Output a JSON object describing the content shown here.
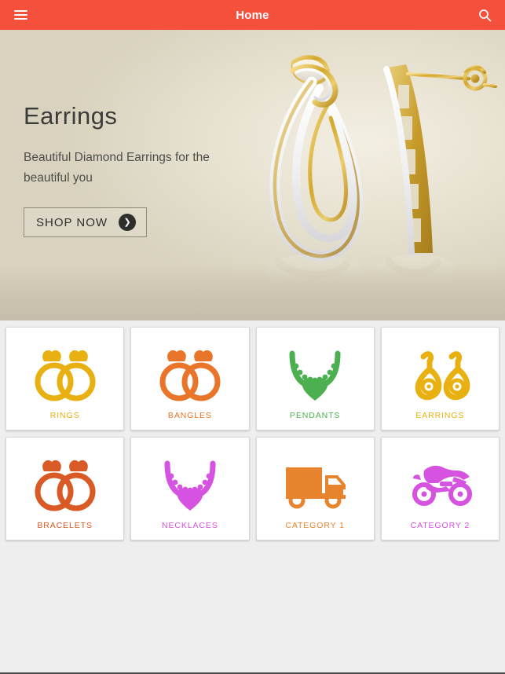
{
  "appbar": {
    "title": "Home",
    "menu_icon": "hamburger-menu-icon",
    "search_icon": "search-icon",
    "background_color": "#f4503c"
  },
  "banner": {
    "title": "Earrings",
    "subtitle": "Beautiful Diamond Earrings for the beautiful you",
    "cta_label": "SHOP NOW",
    "cta_arrow_icon": "chevron-right-icon",
    "image_alt": "gold diamond drop earrings",
    "background_color": "#e9e3d4"
  },
  "categories": [
    {
      "label": "RINGS",
      "icon": "rings-icon",
      "color": "#e8b010"
    },
    {
      "label": "BANGLES",
      "icon": "rings-icon",
      "color": "#e8752a"
    },
    {
      "label": "PENDANTS",
      "icon": "necklace-icon",
      "color": "#4cb050"
    },
    {
      "label": "EARRINGS",
      "icon": "earrings-icon",
      "color": "#e8b010"
    },
    {
      "label": "BRACELETS",
      "icon": "rings-icon",
      "color": "#d95a24"
    },
    {
      "label": "NECKLACES",
      "icon": "necklace-icon",
      "color": "#d council"
    },
    {
      "label": "CATEGORY 1",
      "icon": "truck-icon",
      "color": "#e8842d"
    },
    {
      "label": "CATEGORY 2",
      "icon": "motorcycle-icon",
      "color": "#d champ"
    }
  ],
  "page": {
    "background_color": "#eeeeee"
  }
}
